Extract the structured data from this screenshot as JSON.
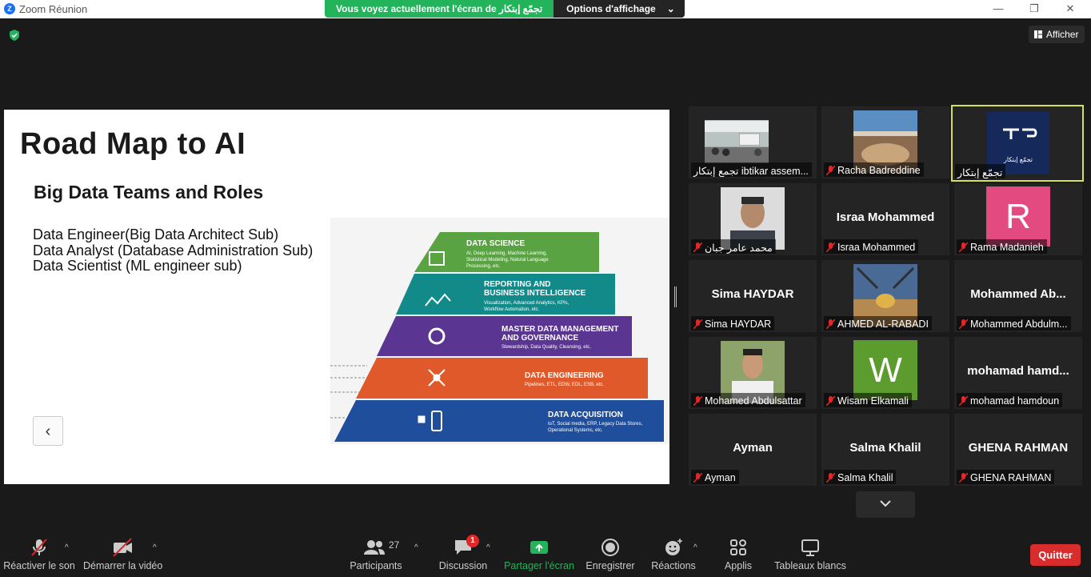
{
  "window": {
    "title": "Zoom Réunion",
    "minimize": "—",
    "maximize": "❐",
    "close": "✕"
  },
  "share_banner": {
    "message": "Vous voyez actuellement l'écran de تجمّع إبتكار",
    "options": "Options d'affichage",
    "options_caret": "⌄"
  },
  "view_button": {
    "label": "Afficher"
  },
  "slide": {
    "title": "Road Map to AI",
    "subtitle": "Big Data Teams and Roles",
    "roles": [
      "Data Engineer(Big Data Architect Sub)",
      "Data Analyst (Database Administration Sub)",
      "Data Scientist (ML engineer sub)"
    ],
    "prev_arrow": "‹",
    "pyramid": [
      {
        "title": "DATA SCIENCE",
        "desc": "AI, Deep Learning, Machine Learning, Statistical Modeling, Natural Language Processing, etc.",
        "color": "#5aa342",
        "icon": "ai-chip-icon"
      },
      {
        "title": "REPORTING AND BUSINESS INTELLIGENCE",
        "desc": "Visualization, Advanced Analytics, KPIs, Workflow Automation, etc.",
        "color": "#138a8a",
        "icon": "chart-icon"
      },
      {
        "title": "MASTER DATA MANAGEMENT AND GOVERNANCE",
        "desc": "Stewardship, Data Quality, Cleansing, etc.",
        "color": "#5a3592",
        "icon": "gear-icon"
      },
      {
        "title": "DATA ENGINEERING",
        "desc": "Pipelines, ETL, EDW, EDL, ESB, etc.",
        "color": "#e0592a",
        "icon": "network-icon"
      },
      {
        "title": "DATA ACQUISITION",
        "desc": "IoT, Social media, ERP, Legacy Data Stores, Operational Systems, etc.",
        "color": "#1f4e9c",
        "icon": "device-icon"
      }
    ]
  },
  "participants_grid": [
    {
      "name": "تجمع إبتكار ibtikar assem...",
      "display": "",
      "tile": "photo",
      "muted": false
    },
    {
      "name": "Racha Badreddine",
      "display": "",
      "tile": "photo",
      "muted": true
    },
    {
      "name": "تجمّع إبتكار",
      "display": "",
      "tile": "logo",
      "muted": false,
      "active": true
    },
    {
      "name": "محمد عامر جبان",
      "display": "",
      "tile": "photo",
      "muted": true
    },
    {
      "name": "Israa Mohammed",
      "display": "Israa Mohammed",
      "tile": "name",
      "muted": true
    },
    {
      "name": "Rama Madanieh",
      "display": "R",
      "tile": "letter",
      "muted": true,
      "color": "#e34a7f"
    },
    {
      "name": "Sima HAYDAR",
      "display": "Sima HAYDAR",
      "tile": "name",
      "muted": true
    },
    {
      "name": "AHMED AL-RABADI",
      "display": "",
      "tile": "photo",
      "muted": true
    },
    {
      "name": "Mohammed Abdulm...",
      "display": "Mohammed Ab...",
      "tile": "name",
      "muted": true
    },
    {
      "name": "Mohamed Abdulsattar",
      "display": "",
      "tile": "photo",
      "muted": true
    },
    {
      "name": "Wisam Elkamali",
      "display": "W",
      "tile": "letter",
      "muted": true,
      "color": "#5c9b2d"
    },
    {
      "name": "mohamad hamdoun",
      "display": "mohamad hamd...",
      "tile": "name",
      "muted": true
    },
    {
      "name": "Ayman",
      "display": "Ayman",
      "tile": "name",
      "muted": true
    },
    {
      "name": "Salma Khalil",
      "display": "Salma Khalil",
      "tile": "name",
      "muted": true
    },
    {
      "name": "GHENA RAHMAN",
      "display": "GHENA RAHMAN",
      "tile": "name",
      "muted": true
    }
  ],
  "logo_text": "تجمّع إبتكار",
  "toolbar": {
    "unmute": "Réactiver le son",
    "start_video": "Démarrer la vidéo",
    "participants": "Participants",
    "participants_count": "27",
    "chat": "Discussion",
    "chat_badge": "1",
    "share": "Partager l'écran",
    "record": "Enregistrer",
    "reactions": "Réactions",
    "apps": "Applis",
    "whiteboards": "Tableaux blancs",
    "leave": "Quitter",
    "caret": "^"
  }
}
